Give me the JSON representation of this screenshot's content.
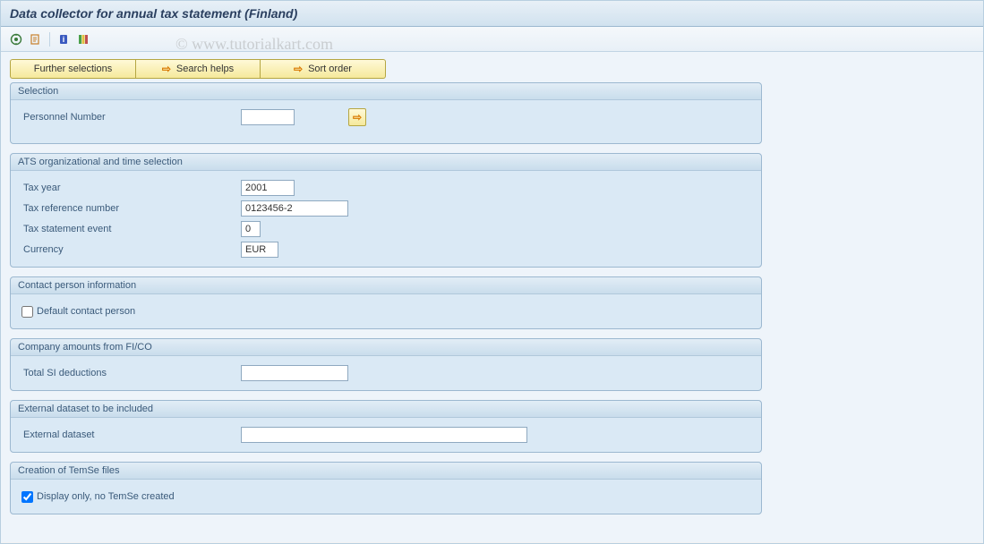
{
  "title": "Data collector for annual tax statement (Finland)",
  "watermark": "© www.tutorialkart.com",
  "buttons": {
    "further_selections": "Further selections",
    "search_helps": "Search helps",
    "sort_order": "Sort order"
  },
  "sections": {
    "selection": {
      "title": "Selection",
      "personnel_number_label": "Personnel Number",
      "personnel_number_value": ""
    },
    "ats": {
      "title": "ATS organizational and time selection",
      "tax_year_label": "Tax year",
      "tax_year_value": "2001",
      "tax_ref_label": "Tax reference number",
      "tax_ref_value": "0123456-2",
      "tax_event_label": "Tax statement event",
      "tax_event_value": "0",
      "currency_label": "Currency",
      "currency_value": "EUR"
    },
    "contact": {
      "title": "Contact person information",
      "default_contact_label": "Default contact person",
      "default_contact_checked": false
    },
    "company": {
      "title": "Company amounts from FI/CO",
      "total_si_label": "Total SI deductions",
      "total_si_value": ""
    },
    "external": {
      "title": "External dataset to be included",
      "dataset_label": "External dataset",
      "dataset_value": ""
    },
    "temse": {
      "title": "Creation of TemSe files",
      "display_only_label": "Display only, no TemSe created",
      "display_only_checked": true
    }
  }
}
